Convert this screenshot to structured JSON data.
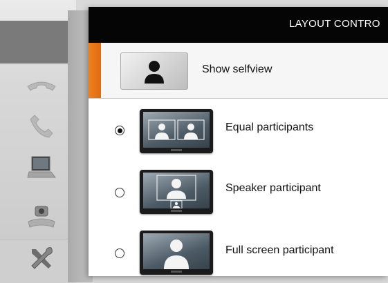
{
  "panel": {
    "title": "LAYOUT CONTRO"
  },
  "selfview": {
    "label": "Show selfview"
  },
  "layouts": [
    {
      "label": "Equal participants",
      "selected": true
    },
    {
      "label": "Speaker participant",
      "selected": false
    },
    {
      "label": "Full screen participant",
      "selected": false
    }
  ],
  "sidebar": {
    "icons": [
      "handset-down-icon",
      "handset-icon",
      "laptop-icon",
      "camera-icon",
      "tools-icon"
    ]
  },
  "colors": {
    "accent": "#f0821e",
    "header": "#050505"
  }
}
